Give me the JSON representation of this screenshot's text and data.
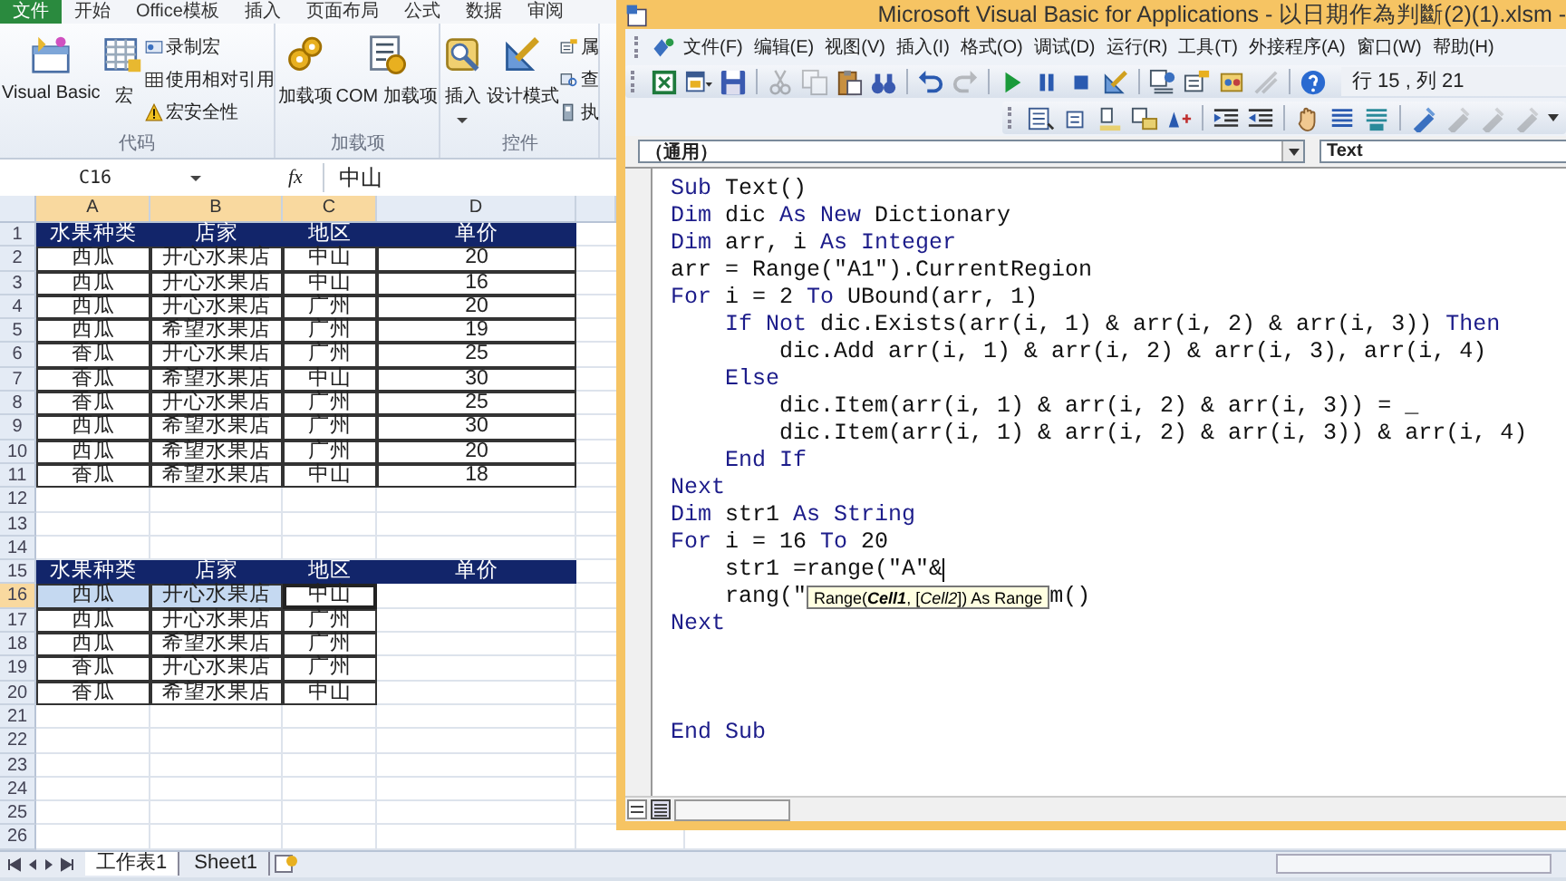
{
  "excel": {
    "ribbon_tabs": [
      {
        "label": "文件",
        "selected": true
      },
      {
        "label": "开始",
        "selected": false
      },
      {
        "label": "Office模板",
        "selected": false
      },
      {
        "label": "插入",
        "selected": false
      },
      {
        "label": "页面布局",
        "selected": false
      },
      {
        "label": "公式",
        "selected": false
      },
      {
        "label": "数据",
        "selected": false
      },
      {
        "label": "审阅",
        "selected": false
      }
    ],
    "ribbon_groups": [
      {
        "label": "代码",
        "large_buttons": [
          {
            "label": "Visual Basic",
            "kind": "vb",
            "dropdown": false
          },
          {
            "label": "宏",
            "kind": "macro",
            "dropdown": false
          }
        ],
        "small_buttons": [
          {
            "label": "录制宏",
            "kind": "record"
          },
          {
            "label": "使用相对引用",
            "kind": "relative"
          },
          {
            "label": "宏安全性",
            "kind": "security"
          }
        ]
      },
      {
        "label": "加载项",
        "large_buttons": [
          {
            "label": "加载项",
            "kind": "addin",
            "dropdown": false
          },
          {
            "label": "COM 加载项",
            "kind": "com",
            "dropdown": false
          }
        ]
      },
      {
        "label": "控件",
        "large_buttons": [
          {
            "label": "插入",
            "kind": "insert",
            "dropdown": true
          },
          {
            "label": "设计模式",
            "kind": "design",
            "dropdown": false
          }
        ],
        "small_buttons": [
          {
            "label": "属",
            "kind": "properties"
          },
          {
            "label": "查",
            "kind": "code"
          },
          {
            "label": "执",
            "kind": "dialog"
          }
        ]
      }
    ],
    "formula_bar": {
      "name_box": "C16",
      "function_label": "fx",
      "value": "中山"
    },
    "columns": [
      {
        "label": "A",
        "selected": true
      },
      {
        "label": "B",
        "selected": true
      },
      {
        "label": "C",
        "selected": true
      },
      {
        "label": "D",
        "selected": false
      }
    ],
    "rows": [
      {
        "number": "1",
        "selected": false,
        "kind": "header",
        "cells": [
          {
            "text": "水果种类",
            "selected": false,
            "active": false
          },
          {
            "text": "店家",
            "selected": false,
            "active": false
          },
          {
            "text": "地区",
            "selected": false,
            "active": false
          },
          {
            "text": "单价",
            "selected": false,
            "active": false
          }
        ]
      },
      {
        "number": "2",
        "selected": false,
        "kind": "table",
        "cells": [
          {
            "text": "西瓜",
            "selected": false,
            "active": false
          },
          {
            "text": "开心水果店",
            "selected": false,
            "active": false
          },
          {
            "text": "中山",
            "selected": false,
            "active": false
          },
          {
            "text": "20",
            "selected": false,
            "active": false
          }
        ]
      },
      {
        "number": "3",
        "selected": false,
        "kind": "table",
        "cells": [
          {
            "text": "西瓜",
            "selected": false,
            "active": false
          },
          {
            "text": "开心水果店",
            "selected": false,
            "active": false
          },
          {
            "text": "中山",
            "selected": false,
            "active": false
          },
          {
            "text": "16",
            "selected": false,
            "active": false
          }
        ]
      },
      {
        "number": "4",
        "selected": false,
        "kind": "table",
        "cells": [
          {
            "text": "西瓜",
            "selected": false,
            "active": false
          },
          {
            "text": "开心水果店",
            "selected": false,
            "active": false
          },
          {
            "text": "广州",
            "selected": false,
            "active": false
          },
          {
            "text": "20",
            "selected": false,
            "active": false
          }
        ]
      },
      {
        "number": "5",
        "selected": false,
        "kind": "table",
        "cells": [
          {
            "text": "西瓜",
            "selected": false,
            "active": false
          },
          {
            "text": "希望水果店",
            "selected": false,
            "active": false
          },
          {
            "text": "广州",
            "selected": false,
            "active": false
          },
          {
            "text": "19",
            "selected": false,
            "active": false
          }
        ]
      },
      {
        "number": "6",
        "selected": false,
        "kind": "table",
        "cells": [
          {
            "text": "香瓜",
            "selected": false,
            "active": false
          },
          {
            "text": "开心水果店",
            "selected": false,
            "active": false
          },
          {
            "text": "广州",
            "selected": false,
            "active": false
          },
          {
            "text": "25",
            "selected": false,
            "active": false
          }
        ]
      },
      {
        "number": "7",
        "selected": false,
        "kind": "table",
        "cells": [
          {
            "text": "香瓜",
            "selected": false,
            "active": false
          },
          {
            "text": "希望水果店",
            "selected": false,
            "active": false
          },
          {
            "text": "中山",
            "selected": false,
            "active": false
          },
          {
            "text": "30",
            "selected": false,
            "active": false
          }
        ]
      },
      {
        "number": "8",
        "selected": false,
        "kind": "table",
        "cells": [
          {
            "text": "香瓜",
            "selected": false,
            "active": false
          },
          {
            "text": "开心水果店",
            "selected": false,
            "active": false
          },
          {
            "text": "广州",
            "selected": false,
            "active": false
          },
          {
            "text": "25",
            "selected": false,
            "active": false
          }
        ]
      },
      {
        "number": "9",
        "selected": false,
        "kind": "table",
        "cells": [
          {
            "text": "西瓜",
            "selected": false,
            "active": false
          },
          {
            "text": "希望水果店",
            "selected": false,
            "active": false
          },
          {
            "text": "广州",
            "selected": false,
            "active": false
          },
          {
            "text": "30",
            "selected": false,
            "active": false
          }
        ]
      },
      {
        "number": "10",
        "selected": false,
        "kind": "table",
        "cells": [
          {
            "text": "西瓜",
            "selected": false,
            "active": false
          },
          {
            "text": "希望水果店",
            "selected": false,
            "active": false
          },
          {
            "text": "广州",
            "selected": false,
            "active": false
          },
          {
            "text": "20",
            "selected": false,
            "active": false
          }
        ]
      },
      {
        "number": "11",
        "selected": false,
        "kind": "table",
        "cells": [
          {
            "text": "香瓜",
            "selected": false,
            "active": false
          },
          {
            "text": "希望水果店",
            "selected": false,
            "active": false
          },
          {
            "text": "中山",
            "selected": false,
            "active": false
          },
          {
            "text": "18",
            "selected": false,
            "active": false
          }
        ]
      },
      {
        "number": "12",
        "selected": false,
        "kind": "empty"
      },
      {
        "number": "13",
        "selected": false,
        "kind": "empty"
      },
      {
        "number": "14",
        "selected": false,
        "kind": "empty"
      },
      {
        "number": "15",
        "selected": false,
        "kind": "header",
        "cells": [
          {
            "text": "水果种类",
            "selected": false,
            "active": false
          },
          {
            "text": "店家",
            "selected": false,
            "active": false
          },
          {
            "text": "地区",
            "selected": false,
            "active": false
          },
          {
            "text": "单价",
            "selected": false,
            "active": false
          }
        ]
      },
      {
        "number": "16",
        "selected": true,
        "kind": "table",
        "cells": [
          {
            "text": "西瓜",
            "selected": true,
            "active": false
          },
          {
            "text": "开心水果店",
            "selected": true,
            "active": false
          },
          {
            "text": "中山",
            "selected": false,
            "active": true
          }
        ]
      },
      {
        "number": "17",
        "selected": false,
        "kind": "table",
        "cells": [
          {
            "text": "西瓜",
            "selected": false,
            "active": false
          },
          {
            "text": "开心水果店",
            "selected": false,
            "active": false
          },
          {
            "text": "广州",
            "selected": false,
            "active": false
          }
        ]
      },
      {
        "number": "18",
        "selected": false,
        "kind": "table",
        "cells": [
          {
            "text": "西瓜",
            "selected": false,
            "active": false
          },
          {
            "text": "希望水果店",
            "selected": false,
            "active": false
          },
          {
            "text": "广州",
            "selected": false,
            "active": false
          }
        ]
      },
      {
        "number": "19",
        "selected": false,
        "kind": "table",
        "cells": [
          {
            "text": "香瓜",
            "selected": false,
            "active": false
          },
          {
            "text": "开心水果店",
            "selected": false,
            "active": false
          },
          {
            "text": "广州",
            "selected": false,
            "active": false
          }
        ]
      },
      {
        "number": "20",
        "selected": false,
        "kind": "table",
        "cells": [
          {
            "text": "香瓜",
            "selected": false,
            "active": false
          },
          {
            "text": "希望水果店",
            "selected": false,
            "active": false
          },
          {
            "text": "中山",
            "selected": false,
            "active": false
          }
        ]
      },
      {
        "number": "21",
        "selected": false,
        "kind": "empty"
      },
      {
        "number": "22",
        "selected": false,
        "kind": "empty"
      },
      {
        "number": "23",
        "selected": false,
        "kind": "empty"
      },
      {
        "number": "24",
        "selected": false,
        "kind": "empty"
      },
      {
        "number": "25",
        "selected": false,
        "kind": "empty"
      },
      {
        "number": "26",
        "selected": false,
        "kind": "empty"
      }
    ],
    "sheet_tabs": [
      {
        "label": "工作表1",
        "selected": true
      },
      {
        "label": "Sheet1",
        "selected": false
      }
    ]
  },
  "vba": {
    "title": "Microsoft Visual Basic for Applications - 以日期作為判斷(2)(1).xlsm -",
    "menu": [
      "文件(F)",
      "编辑(E)",
      "视图(V)",
      "插入(I)",
      "格式(O)",
      "调试(D)",
      "运行(R)",
      "工具(T)",
      "外接程序(A)",
      "窗口(W)",
      "帮助(H)"
    ],
    "toolbar": {
      "button_groups": [
        [
          {
            "kind": "excel",
            "disabled": false
          },
          {
            "kind": "form",
            "disabled": false
          },
          {
            "kind": "save",
            "disabled": false
          }
        ],
        [
          {
            "kind": "cut",
            "disabled": true
          },
          {
            "kind": "copy",
            "disabled": true
          },
          {
            "kind": "paste",
            "disabled": false
          },
          {
            "kind": "find",
            "disabled": false
          }
        ],
        [
          {
            "kind": "undo",
            "disabled": false
          },
          {
            "kind": "redo",
            "disabled": true
          }
        ],
        [
          {
            "kind": "run",
            "disabled": false
          },
          {
            "kind": "pause",
            "disabled": false
          },
          {
            "kind": "stop",
            "disabled": false
          },
          {
            "kind": "design",
            "disabled": false
          }
        ],
        [
          {
            "kind": "project",
            "disabled": false
          },
          {
            "kind": "properties",
            "disabled": false
          },
          {
            "kind": "browser",
            "disabled": false
          },
          {
            "kind": "toolbox",
            "disabled": true
          }
        ],
        [
          {
            "kind": "help",
            "disabled": false
          }
        ]
      ],
      "position": "行 15 , 列 21"
    },
    "edit_toolbar": {
      "button_groups": [
        [
          {
            "kind": "list",
            "disabled": false
          },
          {
            "kind": "constants",
            "disabled": false
          },
          {
            "kind": "info",
            "disabled": false
          },
          {
            "kind": "param",
            "disabled": false
          },
          {
            "kind": "word",
            "disabled": false
          }
        ],
        [
          {
            "kind": "indent",
            "disabled": false
          },
          {
            "kind": "outdent",
            "disabled": false
          }
        ],
        [
          {
            "kind": "hand",
            "disabled": false
          },
          {
            "kind": "comment",
            "disabled": false
          },
          {
            "kind": "uncomment",
            "disabled": false
          }
        ],
        [
          {
            "kind": "bookmark",
            "disabled": false
          },
          {
            "kind": "bookmark",
            "disabled": true
          },
          {
            "kind": "bookmark",
            "disabled": true
          },
          {
            "kind": "bookmark",
            "disabled": true
          }
        ]
      ]
    },
    "object_box": "（通用）",
    "procedure_box": "Text",
    "code": [
      {
        "cursor": false,
        "segments": [
          {
            "text": "Sub",
            "kind": "keyword"
          },
          {
            "text": " Text()",
            "kind": "plain"
          }
        ]
      },
      {
        "cursor": false,
        "segments": [
          {
            "text": "Dim",
            "kind": "keyword"
          },
          {
            "text": " dic ",
            "kind": "plain"
          },
          {
            "text": "As New",
            "kind": "keyword"
          },
          {
            "text": " Dictionary",
            "kind": "plain"
          }
        ]
      },
      {
        "cursor": false,
        "segments": [
          {
            "text": "Dim",
            "kind": "keyword"
          },
          {
            "text": " arr, i ",
            "kind": "plain"
          },
          {
            "text": "As Integer",
            "kind": "keyword"
          }
        ]
      },
      {
        "cursor": false,
        "segments": [
          {
            "text": "arr = Range(\"A1\").CurrentRegion",
            "kind": "plain"
          }
        ]
      },
      {
        "cursor": false,
        "segments": [
          {
            "text": "For",
            "kind": "keyword"
          },
          {
            "text": " i = 2 ",
            "kind": "plain"
          },
          {
            "text": "To",
            "kind": "keyword"
          },
          {
            "text": " UBound(arr, 1)",
            "kind": "plain"
          }
        ]
      },
      {
        "cursor": false,
        "segments": [
          {
            "text": "    If Not",
            "kind": "keyword"
          },
          {
            "text": " dic.Exists(arr(i, 1) & arr(i, 2) & arr(i, 3)) ",
            "kind": "plain"
          },
          {
            "text": "Then",
            "kind": "keyword"
          }
        ]
      },
      {
        "cursor": false,
        "segments": [
          {
            "text": "        dic.Add arr(i, 1) & arr(i, 2) & arr(i, 3), arr(i, 4)",
            "kind": "plain"
          }
        ]
      },
      {
        "cursor": false,
        "segments": [
          {
            "text": "    Else",
            "kind": "keyword"
          }
        ]
      },
      {
        "cursor": false,
        "segments": [
          {
            "text": "        dic.Item(arr(i, 1) & arr(i, 2) & arr(i, 3)) = _",
            "kind": "plain"
          }
        ]
      },
      {
        "cursor": false,
        "segments": [
          {
            "text": "        dic.Item(arr(i, 1) & arr(i, 2) & arr(i, 3)) & arr(i, 4)",
            "kind": "plain"
          }
        ]
      },
      {
        "cursor": false,
        "segments": [
          {
            "text": "    End If",
            "kind": "keyword"
          }
        ]
      },
      {
        "cursor": false,
        "segments": [
          {
            "text": "Next",
            "kind": "keyword"
          }
        ]
      },
      {
        "cursor": false,
        "segments": [
          {
            "text": "Dim",
            "kind": "keyword"
          },
          {
            "text": " str1 ",
            "kind": "plain"
          },
          {
            "text": "As String",
            "kind": "keyword"
          }
        ]
      },
      {
        "cursor": false,
        "segments": [
          {
            "text": "For",
            "kind": "keyword"
          },
          {
            "text": " i = 16 ",
            "kind": "plain"
          },
          {
            "text": "To",
            "kind": "keyword"
          },
          {
            "text": " 20",
            "kind": "plain"
          }
        ]
      },
      {
        "cursor": true,
        "segments": [
          {
            "text": "    str1 =range(\"A\"&",
            "kind": "plain"
          }
        ]
      },
      {
        "cursor": false,
        "segments": [
          {
            "text": "    rang(\"",
            "kind": "plain"
          },
          {
            "text": "Range(**Cell1**, [*Cell2*]) As Range",
            "kind": "tooltip"
          },
          {
            "text": "m()",
            "kind": "plain"
          }
        ]
      },
      {
        "cursor": false,
        "segments": [
          {
            "text": "Next",
            "kind": "keyword"
          }
        ]
      },
      {
        "cursor": false
      },
      {
        "cursor": false
      },
      {
        "cursor": false
      },
      {
        "cursor": false,
        "segments": [
          {
            "text": "End Sub",
            "kind": "keyword"
          }
        ]
      }
    ]
  }
}
